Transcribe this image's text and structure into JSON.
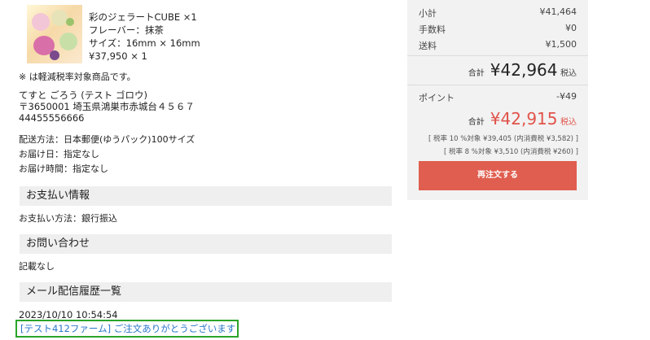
{
  "product": {
    "name": "彩のジェラートCUBE ×1",
    "flavor": "フレーバー：抹茶",
    "size": "サイズ：16mm × 16mm",
    "price": "¥37,950 × 1"
  },
  "reduced_tax_note": "※ は軽減税率対象商品です。",
  "shipping": {
    "recipient": "てすと ごろう (テスト ゴロウ)",
    "address": "〒3650001 埼玉県鴻巣市赤城台４５６７",
    "phone": "44455556666",
    "method": "配送方法：日本郵便(ゆうパック)100サイズ",
    "delivery_date": "お届け日：指定なし",
    "delivery_time": "お届け時間：指定なし"
  },
  "payment": {
    "heading": "お支払い情報",
    "method": "お支払い方法：銀行振込"
  },
  "inquiry": {
    "heading": "お問い合わせ",
    "body": "記載なし"
  },
  "mail_history": {
    "heading": "メール配信履歴一覧",
    "timestamp": "2023/10/10 10:54:54",
    "link": "[テスト412ファーム] ご注文ありがとうございます"
  },
  "summary": {
    "subtotal_label": "小計",
    "subtotal_value": "¥41,464",
    "fee_label": "手数料",
    "fee_value": "¥0",
    "shipping_label": "送料",
    "shipping_value": "¥1,500",
    "total_label": "合計",
    "total_value": "¥42,964",
    "tax_included": "税込",
    "points_label": "ポイント",
    "points_value": "-¥49",
    "grand_total_label": "合計",
    "grand_total_value": "¥42,915",
    "grand_tax_included": "税込",
    "tax10_note": "[ 税率 10 %対象 ¥39,405 (内消費税 ¥3,582) ]",
    "tax8_note": "[ 税率 8 %対象 ¥3,510 (内消費税 ¥260) ]",
    "reorder_label": "再注文する"
  },
  "colors": {
    "accent_red": "#e0534a",
    "reorder_button": "#e05e4f",
    "link_blue": "#2a77c9",
    "highlight_green": "#2aa52a",
    "section_bg": "#efefef",
    "panel_bg": "#f2f2f2"
  }
}
